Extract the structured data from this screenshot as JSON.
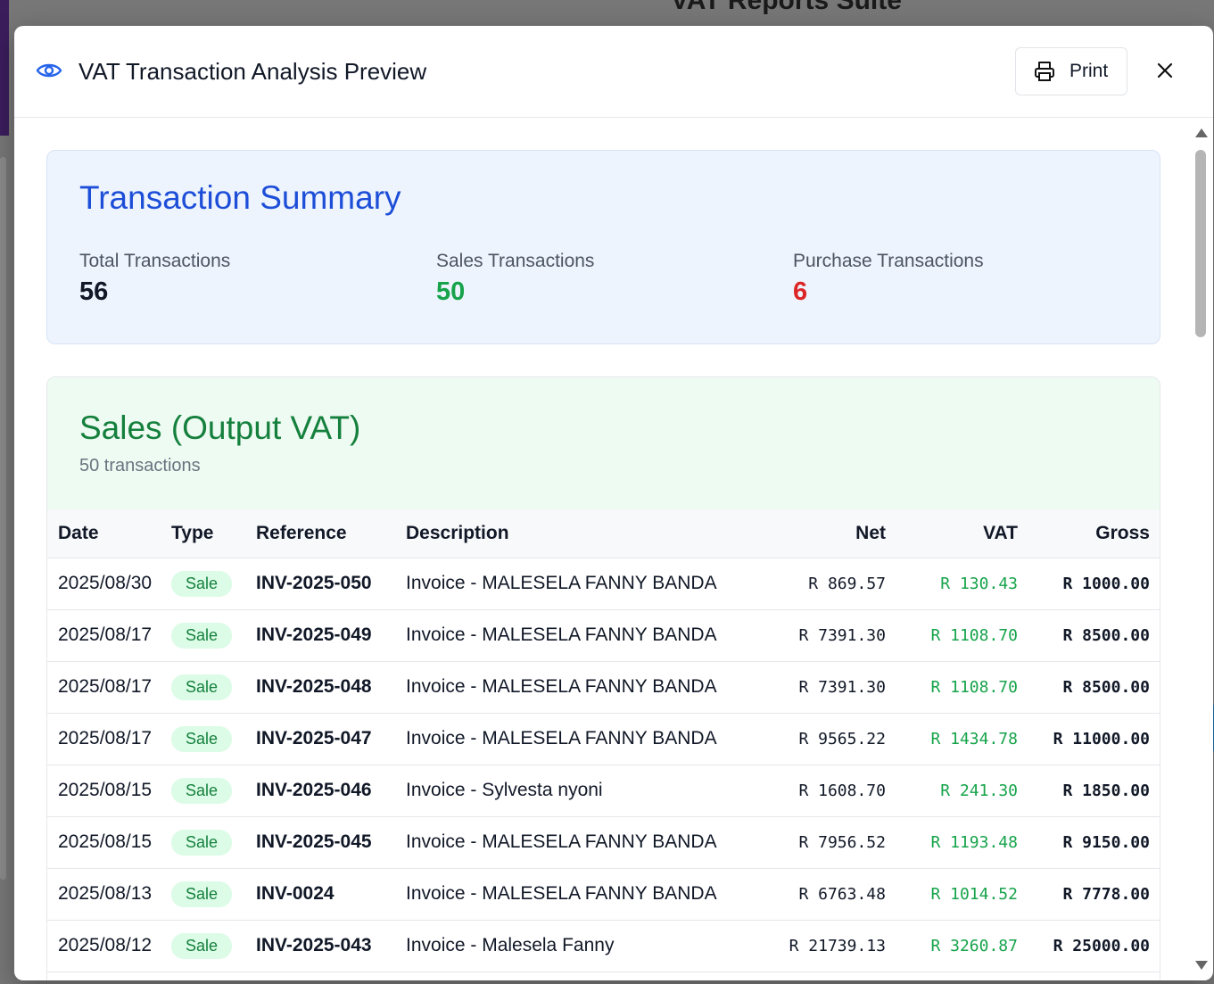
{
  "background": {
    "app_title": "VAT Reports Suite"
  },
  "modal": {
    "title": "VAT Transaction Analysis Preview",
    "print_label": "Print"
  },
  "summary": {
    "title": "Transaction Summary",
    "stats": [
      {
        "label": "Total Transactions",
        "value": "56",
        "color": "#111827"
      },
      {
        "label": "Sales Transactions",
        "value": "50",
        "color": "#16a34a"
      },
      {
        "label": "Purchase Transactions",
        "value": "6",
        "color": "#dc2626"
      }
    ]
  },
  "sales": {
    "title": "Sales (Output VAT)",
    "subtitle": "50 transactions",
    "columns": [
      "Date",
      "Type",
      "Reference",
      "Description",
      "Net",
      "VAT",
      "Gross"
    ],
    "rows": [
      {
        "date": "2025/08/30",
        "type": "Sale",
        "reference": "INV-2025-050",
        "description": "Invoice - MALESELA FANNY BANDA",
        "net": "R 869.57",
        "vat": "R 130.43",
        "gross": "R 1000.00"
      },
      {
        "date": "2025/08/17",
        "type": "Sale",
        "reference": "INV-2025-049",
        "description": "Invoice - MALESELA FANNY BANDA",
        "net": "R 7391.30",
        "vat": "R 1108.70",
        "gross": "R 8500.00"
      },
      {
        "date": "2025/08/17",
        "type": "Sale",
        "reference": "INV-2025-048",
        "description": "Invoice - MALESELA FANNY BANDA",
        "net": "R 7391.30",
        "vat": "R 1108.70",
        "gross": "R 8500.00"
      },
      {
        "date": "2025/08/17",
        "type": "Sale",
        "reference": "INV-2025-047",
        "description": "Invoice - MALESELA FANNY BANDA",
        "net": "R 9565.22",
        "vat": "R 1434.78",
        "gross": "R 11000.00"
      },
      {
        "date": "2025/08/15",
        "type": "Sale",
        "reference": "INV-2025-046",
        "description": "Invoice - Sylvesta nyoni",
        "net": "R 1608.70",
        "vat": "R 241.30",
        "gross": "R 1850.00"
      },
      {
        "date": "2025/08/15",
        "type": "Sale",
        "reference": "INV-2025-045",
        "description": "Invoice - MALESELA FANNY BANDA",
        "net": "R 7956.52",
        "vat": "R 1193.48",
        "gross": "R 9150.00"
      },
      {
        "date": "2025/08/13",
        "type": "Sale",
        "reference": "INV-0024",
        "description": "Invoice - MALESELA FANNY BANDA",
        "net": "R 6763.48",
        "vat": "R 1014.52",
        "gross": "R 7778.00"
      },
      {
        "date": "2025/08/12",
        "type": "Sale",
        "reference": "INV-2025-043",
        "description": "Invoice - Malesela Fanny",
        "net": "R 21739.13",
        "vat": "R 3260.87",
        "gross": "R 25000.00"
      }
    ]
  }
}
